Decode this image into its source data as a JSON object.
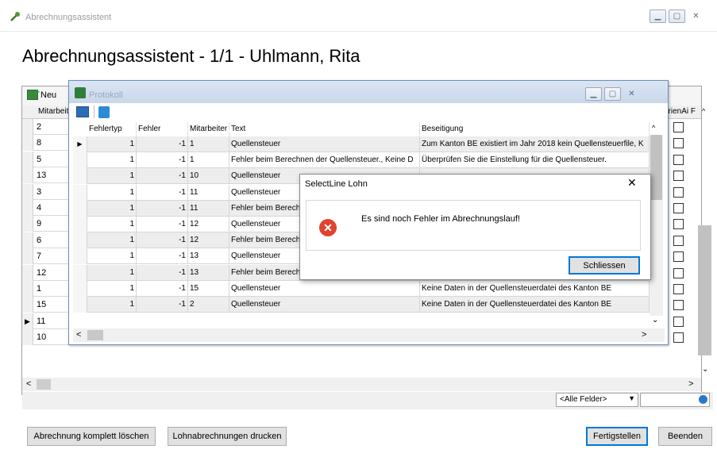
{
  "main_window": {
    "title": "Abrechnungsassistent",
    "heading": "Abrechnungsassistent - 1/1 - Uhlmann, Rita",
    "toolbar_new": "Neu",
    "grid_header_mitarbeiter": "Mitarbeit",
    "grid_header_right": "erienAi F",
    "rows": [
      "2",
      "8",
      "5",
      "13",
      "3",
      "4",
      "9",
      "6",
      "7",
      "12",
      "1",
      "15",
      "11",
      "10"
    ],
    "current_row_index": 12,
    "filter_select": "<Alle Felder>",
    "buttons": {
      "delete_all": "Abrechnung komplett löschen",
      "print": "Lohnabrechnungen drucken",
      "finish": "Fertigstellen",
      "close": "Beenden"
    }
  },
  "protokoll": {
    "title": "Protokoll",
    "columns": [
      "Fehlertyp",
      "Fehler",
      "Mitarbeiter",
      "Text",
      "Beseitigung"
    ],
    "rows": [
      {
        "typ": "1",
        "fehler": "-1",
        "ma": "1",
        "text": "Quellensteuer",
        "beseitigung": "Zum Kanton BE existiert im Jahr 2018 kein Quellensteuerfile, K"
      },
      {
        "typ": "1",
        "fehler": "-1",
        "ma": "1",
        "text": "Fehler beim Berechnen der Quellensteuer., Keine D",
        "beseitigung": "Überprüfen Sie die Einstellung für die Quellensteuer."
      },
      {
        "typ": "1",
        "fehler": "-1",
        "ma": "10",
        "text": "Quellensteuer",
        "beseitigung": ""
      },
      {
        "typ": "1",
        "fehler": "-1",
        "ma": "11",
        "text": "Quellensteuer",
        "beseitigung": ""
      },
      {
        "typ": "1",
        "fehler": "-1",
        "ma": "11",
        "text": "Fehler beim Berech",
        "beseitigung": ""
      },
      {
        "typ": "1",
        "fehler": "-1",
        "ma": "12",
        "text": "Quellensteuer",
        "beseitigung": ""
      },
      {
        "typ": "1",
        "fehler": "-1",
        "ma": "12",
        "text": "Fehler beim Berech",
        "beseitigung": ""
      },
      {
        "typ": "1",
        "fehler": "-1",
        "ma": "13",
        "text": "Quellensteuer",
        "beseitigung": ""
      },
      {
        "typ": "1",
        "fehler": "-1",
        "ma": "13",
        "text": "Fehler beim Berech",
        "beseitigung": ""
      },
      {
        "typ": "1",
        "fehler": "-1",
        "ma": "15",
        "text": "Quellensteuer",
        "beseitigung": "Keine Daten in der Quellensteuerdatei des Kanton BE"
      },
      {
        "typ": "1",
        "fehler": "-1",
        "ma": "2",
        "text": "Quellensteuer",
        "beseitigung": "Keine Daten in der Quellensteuerdatei des Kanton BE"
      }
    ]
  },
  "dialog": {
    "title": "SelectLine Lohn",
    "close_glyph": "✕",
    "message": "Es sind noch Fehler im Abrechnungslauf!",
    "button": "Schliessen"
  }
}
